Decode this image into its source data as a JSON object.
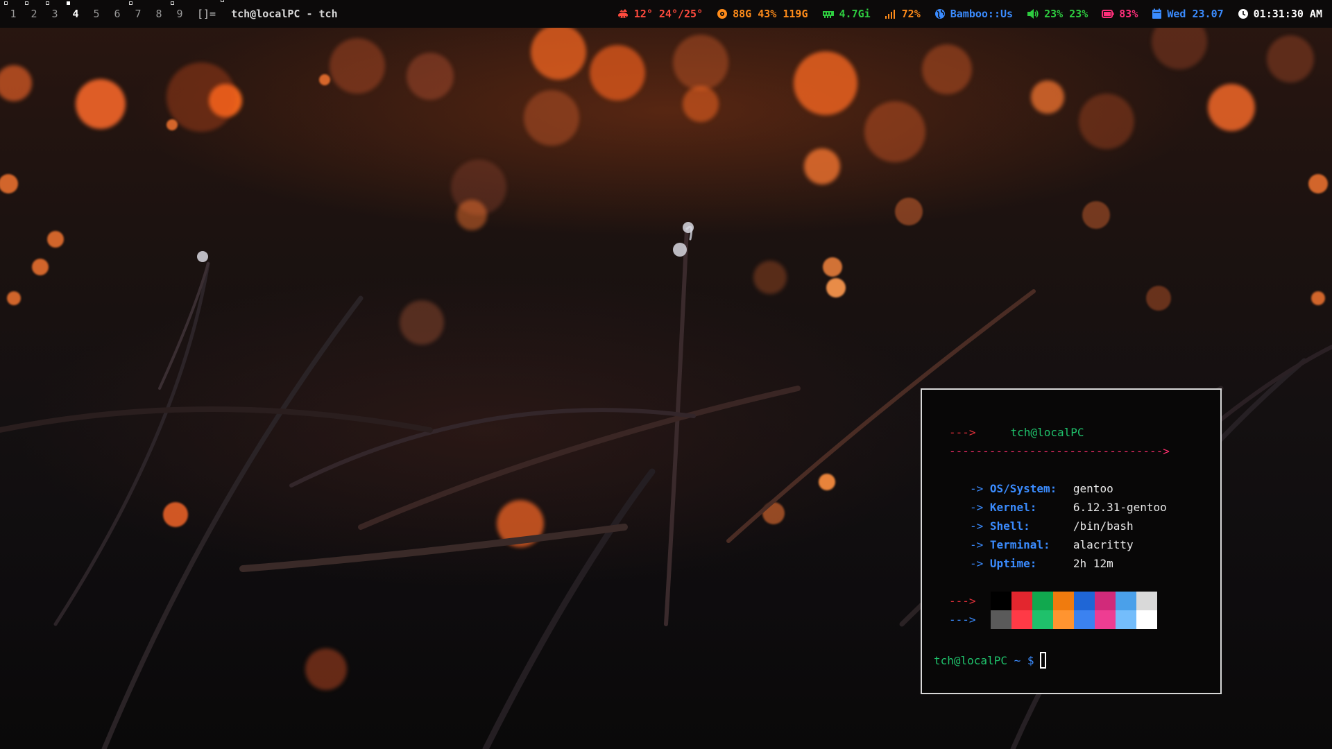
{
  "topbar": {
    "workspaces": [
      "1",
      "2",
      "3",
      "4",
      "5",
      "6",
      "7",
      "8",
      "9"
    ],
    "active_workspace": "4",
    "layout": "[]=",
    "window_title": "tch@localPC - tch",
    "weather": {
      "icon": "weather-icon",
      "text": "12° 24°/25°",
      "color": "#ff4b3e"
    },
    "disk": {
      "icon": "disk-icon",
      "text": "88G 43% 119G",
      "color": "#ff8c1a"
    },
    "memory": {
      "icon": "memory-icon",
      "text": "4.7Gi",
      "color": "#2ecc40"
    },
    "cpu": {
      "icon": "signal-bars-icon",
      "text": "72%",
      "color": "#ff8c1a"
    },
    "keyboard": {
      "icon": "globe-icon",
      "text": "Bamboo::Us",
      "color": "#3b8cff"
    },
    "volume": {
      "icon": "speaker-icon",
      "text": "23% 23%",
      "color": "#2ecc40"
    },
    "battery": {
      "icon": "battery-icon",
      "text": "83%",
      "color": "#ff2f7a"
    },
    "date": {
      "icon": "calendar-icon",
      "text": "Wed 23.07",
      "color": "#3b8cff"
    },
    "clock": {
      "icon": "clock-icon",
      "text": "01:31:30 AM",
      "color": "#ffffff"
    }
  },
  "terminal": {
    "header_arrow": "--->",
    "header_user": "tch@localPC",
    "divider": "-------------------------------->",
    "info": [
      {
        "arrow": "->",
        "key": "OS/System:",
        "value": "gentoo"
      },
      {
        "arrow": "->",
        "key": "Kernel:",
        "value": "6.12.31-gentoo"
      },
      {
        "arrow": "->",
        "key": "Shell:",
        "value": "/bin/bash"
      },
      {
        "arrow": "->",
        "key": "Terminal:",
        "value": "alacritty"
      },
      {
        "arrow": "->",
        "key": "Uptime:",
        "value": "2h 12m"
      }
    ],
    "palette_arrow_1": "--->",
    "palette_arrow_2": "--->",
    "palette_row_1": [
      "#000000",
      "#e3262e",
      "#11a84e",
      "#f07b0e",
      "#1f66d6",
      "#d12a7a",
      "#4aa0ea",
      "#d9d9d9"
    ],
    "palette_row_2": [
      "#5a5a5a",
      "#ff3a46",
      "#1fc16b",
      "#ff9430",
      "#3b82f0",
      "#ee3d92",
      "#74bdfb",
      "#ffffff"
    ],
    "prompt_user": "tch@localPC",
    "prompt_path": " ~ $",
    "colors": {
      "red": "#e0303a",
      "green": "#1fc16b",
      "pink": "#ff2f6e",
      "blue": "#3b8cff"
    }
  }
}
